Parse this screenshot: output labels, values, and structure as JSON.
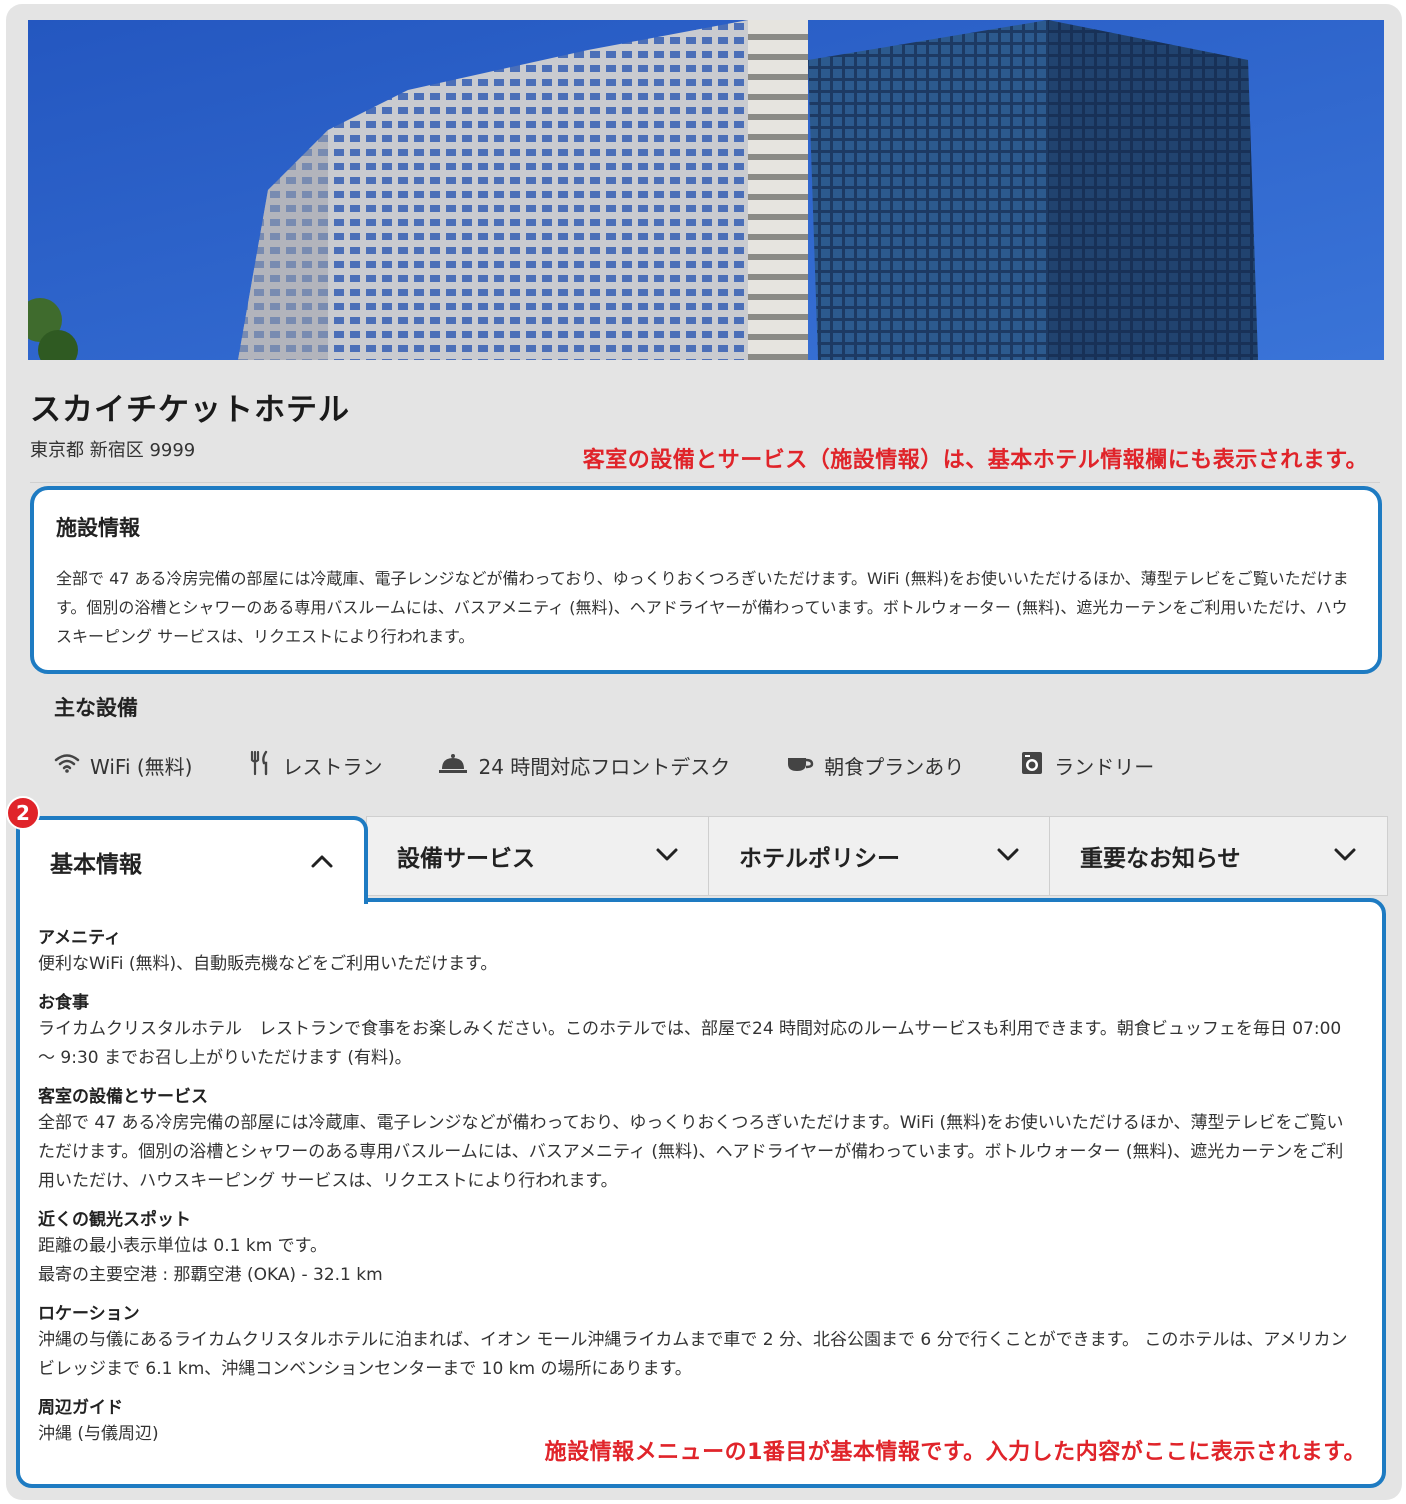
{
  "hotel": {
    "name": "スカイチケットホテル",
    "address": "東京都 新宿区 9999"
  },
  "annotations": {
    "top": "客室の設備とサービス（施設情報）は、基本ホテル情報欄にも表示されます。",
    "bottom": "施設情報メニューの1番目が基本情報です。入力した内容がここに表示されます。",
    "badge": "2"
  },
  "facility": {
    "title": "施設情報",
    "body": "全部で 47 ある冷房完備の部屋には冷蔵庫、電子レンジなどが備わっており、ゆっくりおくつろぎいただけます。WiFi (無料)をお使いいただけるほか、薄型テレビをご覧いただけます。個別の浴槽とシャワーのある専用バスルームには、バスアメニティ (無料)、ヘアドライヤーが備わっています。ボトルウォーター (無料)、遮光カーテンをご利用いただけ、ハウスキーピング サービスは、リクエストにより行われます。"
  },
  "main_amenities": {
    "title": "主な設備",
    "items": [
      {
        "label": "WiFi (無料)",
        "icon": "wifi-icon"
      },
      {
        "label": "レストラン",
        "icon": "restaurant-icon"
      },
      {
        "label": "24 時間対応フロントデスク",
        "icon": "front-desk-bell-icon"
      },
      {
        "label": "朝食プランあり",
        "icon": "coffee-cup-icon"
      },
      {
        "label": "ランドリー",
        "icon": "laundry-icon"
      }
    ]
  },
  "tabs": [
    {
      "label": "基本情報",
      "state": "expanded"
    },
    {
      "label": "設備サービス",
      "state": "collapsed"
    },
    {
      "label": "ホテルポリシー",
      "state": "collapsed"
    },
    {
      "label": "重要なお知らせ",
      "state": "collapsed"
    }
  ],
  "basic_info": {
    "amenity_title": "アメニティ",
    "amenity_body": "便利なWiFi (無料)、自動販売機などをご利用いただけます。",
    "dining_title": "お食事",
    "dining_body": "ライカムクリスタルホテル　レストランで食事をお楽しみください。このホテルでは、部屋で24 時間対応のルームサービスも利用できます。朝食ビュッフェを毎日 07:00 ～ 9:30 までお召し上がりいただけます (有料)。",
    "room_title": "客室の設備とサービス",
    "room_body": "全部で 47 ある冷房完備の部屋には冷蔵庫、電子レンジなどが備わっており、ゆっくりおくつろぎいただけます。WiFi (無料)をお使いいただけるほか、薄型テレビをご覧いただけます。個別の浴槽とシャワーのある専用バスルームには、バスアメニティ (無料)、ヘアドライヤーが備わっています。ボトルウォーター (無料)、遮光カーテンをご利用いただけ、ハウスキーピング サービスは、リクエストにより行われます。",
    "sights_title": "近くの観光スポット",
    "sights_line1": "距離の最小表示単位は 0.1 km です。",
    "sights_line2": "最寄の主要空港 : 那覇空港 (OKA) - 32.1 km",
    "location_title": "ロケーション",
    "location_body": "沖縄の与儀にあるライカムクリスタルホテルに泊まれば、イオン モール沖縄ライカムまで車で 2 分、北谷公園まで 6 分で行くことができます。 このホテルは、アメリカンビレッジまで 6.1 km、沖縄コンベンションセンターまで 10 km の場所にあります。",
    "guide_title": "周辺ガイド",
    "guide_body": "沖縄 (与儀周辺)"
  },
  "colors": {
    "accent_blue": "#1e7bc2",
    "annotation_red": "#e0242a",
    "sky": "#2d63c9"
  }
}
